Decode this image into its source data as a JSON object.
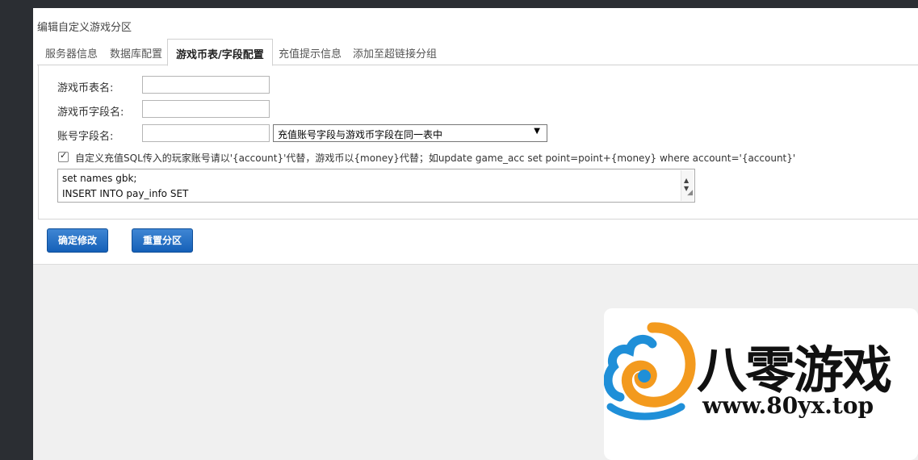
{
  "page": {
    "title": "编辑自定义游戏分区"
  },
  "tabs": [
    {
      "label": "服务器信息",
      "active": false
    },
    {
      "label": "数据库配置",
      "active": false
    },
    {
      "label": "游戏币表/字段配置",
      "active": true
    },
    {
      "label": "充值提示信息",
      "active": false
    },
    {
      "label": "添加至超链接分组",
      "active": false
    }
  ],
  "form": {
    "currency_table_label": "游戏币表名:",
    "currency_table_value": "",
    "currency_field_label": "游戏币字段名:",
    "currency_field_value": "",
    "account_field_label": "账号字段名:",
    "account_field_value": "",
    "account_mode_selected": "充值账号字段与游戏币字段在同一表中",
    "custom_sql_checked": true,
    "custom_sql_label": "自定义充值SQL传入的玩家账号请以'{account}'代替，游戏币以{money}代替；如update game_acc set point=point+{money} where account='{account}'",
    "sql_lines": [
      "set names gbk;",
      "INSERT INTO pay_info SET"
    ]
  },
  "buttons": {
    "confirm": "确定修改",
    "reset": "重置分区"
  },
  "watermark": {
    "brand": "八零游戏",
    "url": "www.80yx.top"
  },
  "colors": {
    "button": "#1a66bd",
    "sidebar": "#2b2e33",
    "logo_orange": "#f39a1e",
    "logo_blue": "#1f8fd8"
  }
}
